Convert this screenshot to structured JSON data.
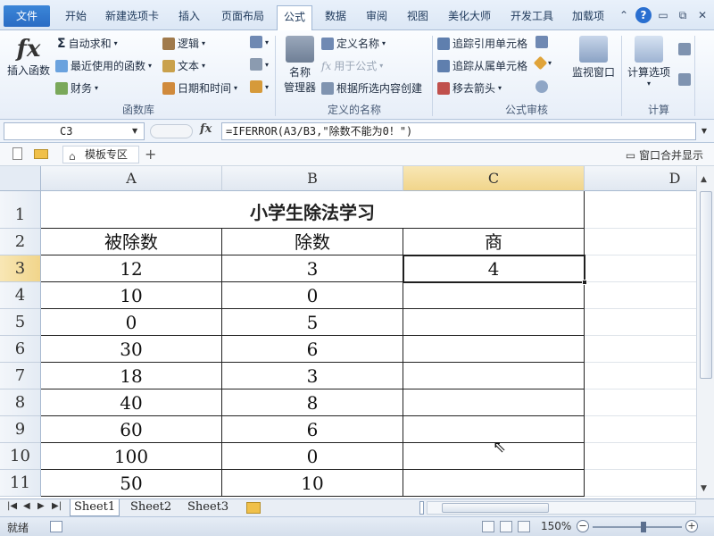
{
  "menu": {
    "file": "文件",
    "tabs": [
      "开始",
      "新建选项卡",
      "插入",
      "页面布局",
      "公式",
      "数据",
      "审阅",
      "视图",
      "美化大师",
      "开发工具",
      "加载项"
    ],
    "active_tab": "公式"
  },
  "ribbon": {
    "library": {
      "insert_function": "插入函数",
      "autosum": "自动求和",
      "recent": "最近使用的函数",
      "financial": "财务",
      "logical": "逻辑",
      "text": "文本",
      "datetime": "日期和时间",
      "group_label": "函数库"
    },
    "names": {
      "name_manager_1": "名称",
      "name_manager_2": "管理器",
      "define_name": "定义名称",
      "use_in_formula": "用于公式",
      "create_from_selection": "根据所选内容创建",
      "group_label": "定义的名称"
    },
    "audit": {
      "trace_precedents": "追踪引用单元格",
      "trace_dependents": "追踪从属单元格",
      "remove_arrows": "移去箭头",
      "watch_window": "监视窗口",
      "group_label": "公式审核"
    },
    "calc": {
      "calc_options": "计算选项",
      "group_label": "计算"
    }
  },
  "formula_bar": {
    "name_box": "C3",
    "fx": "fx",
    "formula": "=IFERROR(A3/B3,\"除数不能为0！\")"
  },
  "doc_tabs": {
    "tab_label": "模板专区",
    "merge_windows": "窗口合并显示"
  },
  "grid": {
    "columns": [
      "A",
      "B",
      "C",
      "D"
    ],
    "rows": [
      "1",
      "2",
      "3",
      "4",
      "5",
      "6",
      "7",
      "8",
      "9",
      "10",
      "11"
    ],
    "title": "小学生除法学习",
    "headers": [
      "被除数",
      "除数",
      "商"
    ],
    "data": [
      [
        "12",
        "3",
        "4"
      ],
      [
        "10",
        "0",
        ""
      ],
      [
        "0",
        "5",
        ""
      ],
      [
        "30",
        "6",
        ""
      ],
      [
        "18",
        "3",
        ""
      ],
      [
        "40",
        "8",
        ""
      ],
      [
        "60",
        "6",
        ""
      ],
      [
        "100",
        "0",
        ""
      ],
      [
        "50",
        "10",
        ""
      ]
    ]
  },
  "sheets": {
    "tabs": [
      "Sheet1",
      "Sheet2",
      "Sheet3"
    ],
    "active": "Sheet1"
  },
  "status": {
    "ready": "就绪",
    "zoom": "150%"
  }
}
